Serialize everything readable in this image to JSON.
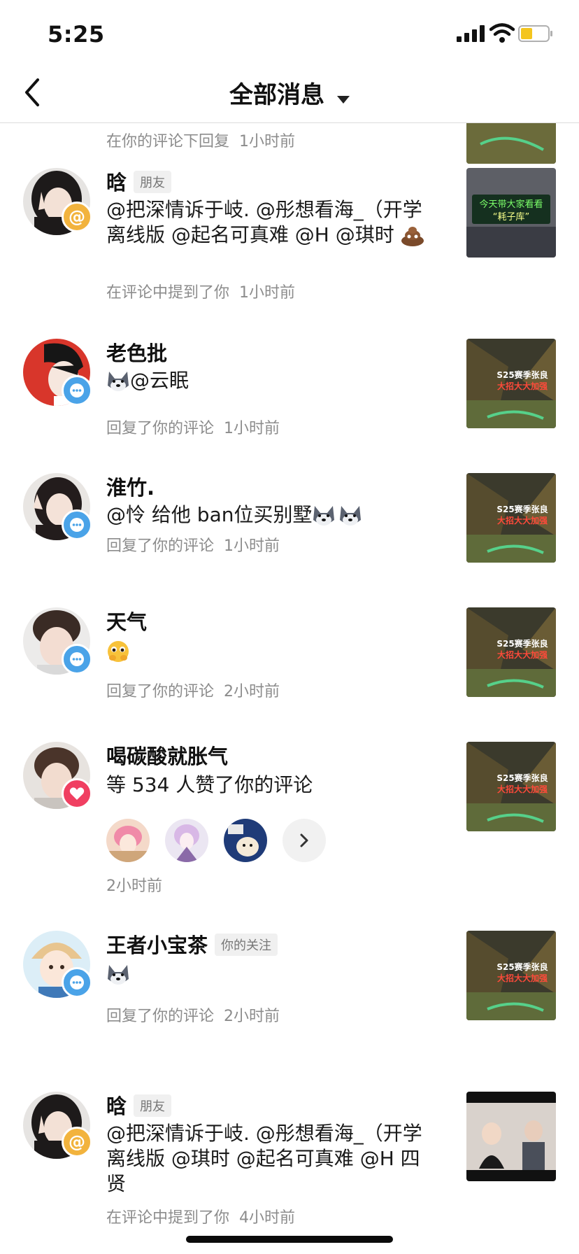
{
  "status_bar": {
    "time": "5:25"
  },
  "header": {
    "title": "全部消息"
  },
  "partial_item": {
    "meta": "在你的评论下回复",
    "time": "1小时前"
  },
  "notifications": [
    {
      "name": "晗",
      "tag": "朋友",
      "text": "@把深情诉于岐. @彤想看海_（开学离线版 @起名可真难 @H @琪时",
      "meta": "在评论中提到了你",
      "time": "1小时前",
      "badge": "at-icon",
      "thumb_text1": "今天带大家看看",
      "thumb_text2": "“耗子库”"
    },
    {
      "name": "老色批",
      "text": "@云眠",
      "meta": "回复了你的评论",
      "time": "1小时前",
      "badge": "message-icon",
      "thumb_text1": "S25赛季张良",
      "thumb_text2": "大招大大加强"
    },
    {
      "name": "淮竹.",
      "text": "@怜 给他 ban位买别墅",
      "meta": "回复了你的评论",
      "time": "1小时前",
      "badge": "message-icon",
      "thumb_text1": "S25赛季张良",
      "thumb_text2": "大招大大加强"
    },
    {
      "name": "天气",
      "text": "",
      "meta": "回复了你的评论",
      "time": "2小时前",
      "badge": "message-icon",
      "thumb_text1": "S25赛季张良",
      "thumb_text2": "大招大大加强"
    },
    {
      "name": "喝碳酸就胀气",
      "text": "等 534 人赞了你的评论",
      "time": "2小时前",
      "badge": "heart-icon",
      "thumb_text1": "S25赛季张良",
      "thumb_text2": "大招大大加强"
    },
    {
      "name": "王者小宝茶",
      "tag": "你的关注",
      "text": "",
      "meta": "回复了你的评论",
      "time": "2小时前",
      "badge": "message-icon",
      "thumb_text1": "S25赛季张良",
      "thumb_text2": "大招大大加强"
    },
    {
      "name": "晗",
      "tag": "朋友",
      "text": "@把深情诉于岐. @彤想看海_（开学离线版 @琪时 @起名可真难 @H 四贤",
      "meta": "在评论中提到了你",
      "time": "4小时前",
      "badge": "at-icon"
    }
  ],
  "colors": {
    "at_badge": "#f2b33d",
    "message_badge": "#4aa3e8",
    "like_badge": "#f03f61",
    "meta_text": "#8c8c8c"
  }
}
